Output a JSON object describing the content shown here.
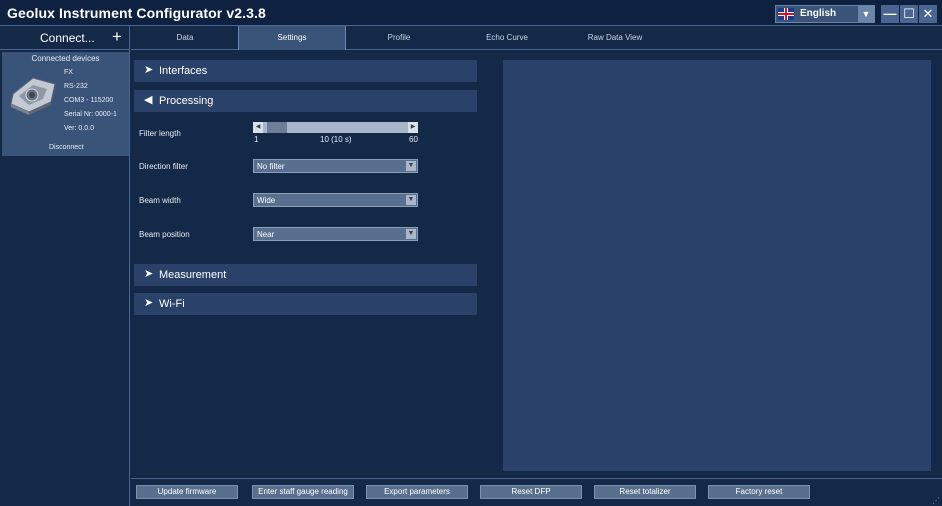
{
  "app": {
    "title": "Geolux Instrument Configurator v2.3.8"
  },
  "language": {
    "selected": "English"
  },
  "window_controls": {
    "minimize": "—",
    "maximize": "☐",
    "close": "✕"
  },
  "sidebar": {
    "connect_label": "Connect...",
    "connect_plus": "+",
    "devices_title": "Connected devices",
    "device": {
      "model": "FX",
      "interface": "RS-232",
      "port": "COM3 - 115200",
      "serial": "Serial Nr: 0000-1",
      "version": "Ver: 0.0.0",
      "disconnect_label": "Disconnect"
    }
  },
  "tabs": [
    {
      "label": "Data"
    },
    {
      "label": "Settings"
    },
    {
      "label": "Profile"
    },
    {
      "label": "Echo Curve"
    },
    {
      "label": "Raw Data View"
    }
  ],
  "active_tab": "Settings",
  "sections": {
    "interfaces": {
      "label": "Interfaces",
      "expanded": false
    },
    "processing": {
      "label": "Processing",
      "expanded": true
    },
    "measurement": {
      "label": "Measurement",
      "expanded": false
    },
    "wifi": {
      "label": "Wi-Fi",
      "expanded": false
    }
  },
  "processing": {
    "filter_length": {
      "label": "Filter length",
      "min": "1",
      "max": "60",
      "value_label": "10 (10 s)",
      "value": 10
    },
    "direction_filter": {
      "label": "Direction filter",
      "value": "No filter"
    },
    "beam_width": {
      "label": "Beam width",
      "value": "Wide"
    },
    "beam_position": {
      "label": "Beam position",
      "value": "Near"
    }
  },
  "bottom_buttons": [
    {
      "label": "Update firmware"
    },
    {
      "label": "Enter staff gauge reading"
    },
    {
      "label": "Export parameters"
    },
    {
      "label": "Reset DFP"
    },
    {
      "label": "Reset totalizer"
    },
    {
      "label": "Factory reset"
    }
  ],
  "colors": {
    "background": "#142848",
    "panel": "#2a426a",
    "accent": "#3a5378"
  }
}
